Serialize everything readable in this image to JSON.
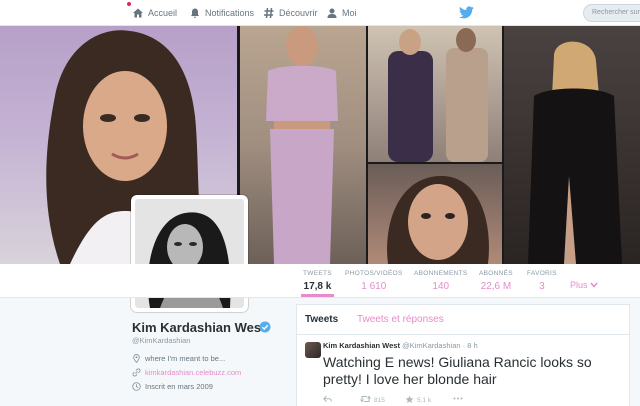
{
  "nav": {
    "home": "Accueil",
    "notifications": "Notifications",
    "discover": "Découvrir",
    "me": "Moi",
    "search_placeholder": "Rechercher sur"
  },
  "icons": {
    "home": "home-icon",
    "notifications": "bell-icon",
    "discover": "hashtag-icon",
    "me": "person-icon",
    "brand": "twitter-bird-icon"
  },
  "colors": {
    "accent": "#e58cc9",
    "brand": "#55acee",
    "verified": "#55acee"
  },
  "stats": [
    {
      "label": "TWEETS",
      "value": "17,8 k",
      "active": true
    },
    {
      "label": "PHOTOS/VIDÉOS",
      "value": "1 610"
    },
    {
      "label": "ABONNEMENTS",
      "value": "140"
    },
    {
      "label": "ABONNÉS",
      "value": "22,6 M"
    },
    {
      "label": "FAVORIS",
      "value": "3"
    }
  ],
  "more_label": "Plus",
  "profile": {
    "name": "Kim Kardashian West",
    "handle": "@KimKardashian",
    "location": "where I'm meant to be...",
    "url": "kimkardashian.celebuzz.com",
    "joined": "Inscrit en mars 2009"
  },
  "timeline": {
    "tab_tweets": "Tweets",
    "tab_replies": "Tweets et réponses"
  },
  "tweet": {
    "author": "Kim Kardashian West",
    "handle": "@KimKardashian",
    "time": "· 8 h",
    "text": "Watching E news! Giuliana Rancic looks so pretty! I love her blonde hair",
    "retweets": "815",
    "favorites": "5,1 k"
  }
}
